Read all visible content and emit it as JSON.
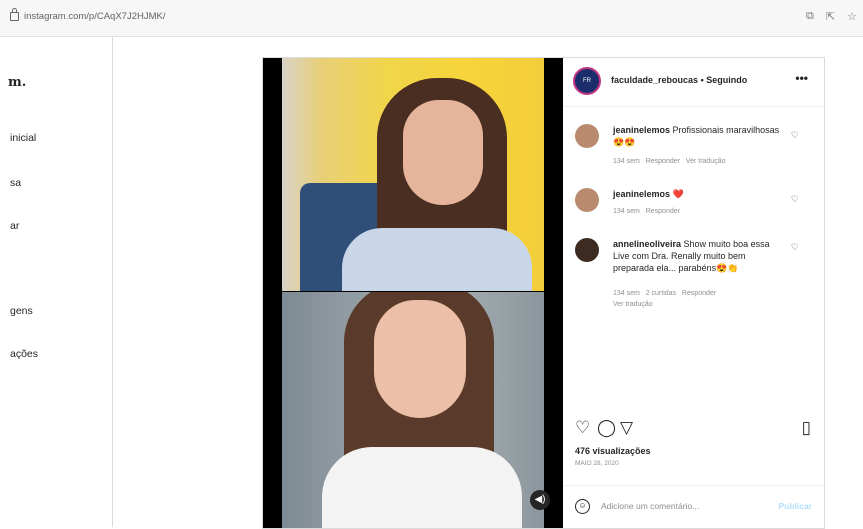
{
  "browser": {
    "url": "instagram.com/p/CAqX7J2HJMK/",
    "icons": [
      "share-icon",
      "zoom-icon",
      "star-icon"
    ]
  },
  "nav": {
    "logo": "m.",
    "items": [
      {
        "label": "inicial"
      },
      {
        "label": "sa"
      },
      {
        "label": "ar"
      },
      {
        "label": "gens"
      },
      {
        "label": "ações"
      }
    ]
  },
  "post": {
    "account": "faculdade_reboucas",
    "separator": "•",
    "follow_status": "Seguindo",
    "more": "•••",
    "comments": [
      {
        "user": "jeaninelemos",
        "text": "Profissionais maravilhosas😍😍",
        "meta": [
          "134 sem",
          "Responder",
          "Ver tradução"
        ]
      },
      {
        "user": "jeaninelemos",
        "text": "❤️",
        "meta": [
          "134 sem",
          "Responder"
        ]
      },
      {
        "user": "annelineoliveira",
        "text": "Show muito boa essa Live com Dra. Renally muito bem preparada ela... parabéns😍👏",
        "meta": [
          "134 sem",
          "2 curtidas",
          "Responder"
        ],
        "extra": "Ver tradução"
      }
    ],
    "views": "476 visualizações",
    "date": "MAIO 28, 2020",
    "add_comment_placeholder": "Adicione um comentário...",
    "publish": "Publicar"
  },
  "colors": {
    "border": "#dbdbdb",
    "muted": "#8e8e8e",
    "publish": "#b2dffc"
  }
}
